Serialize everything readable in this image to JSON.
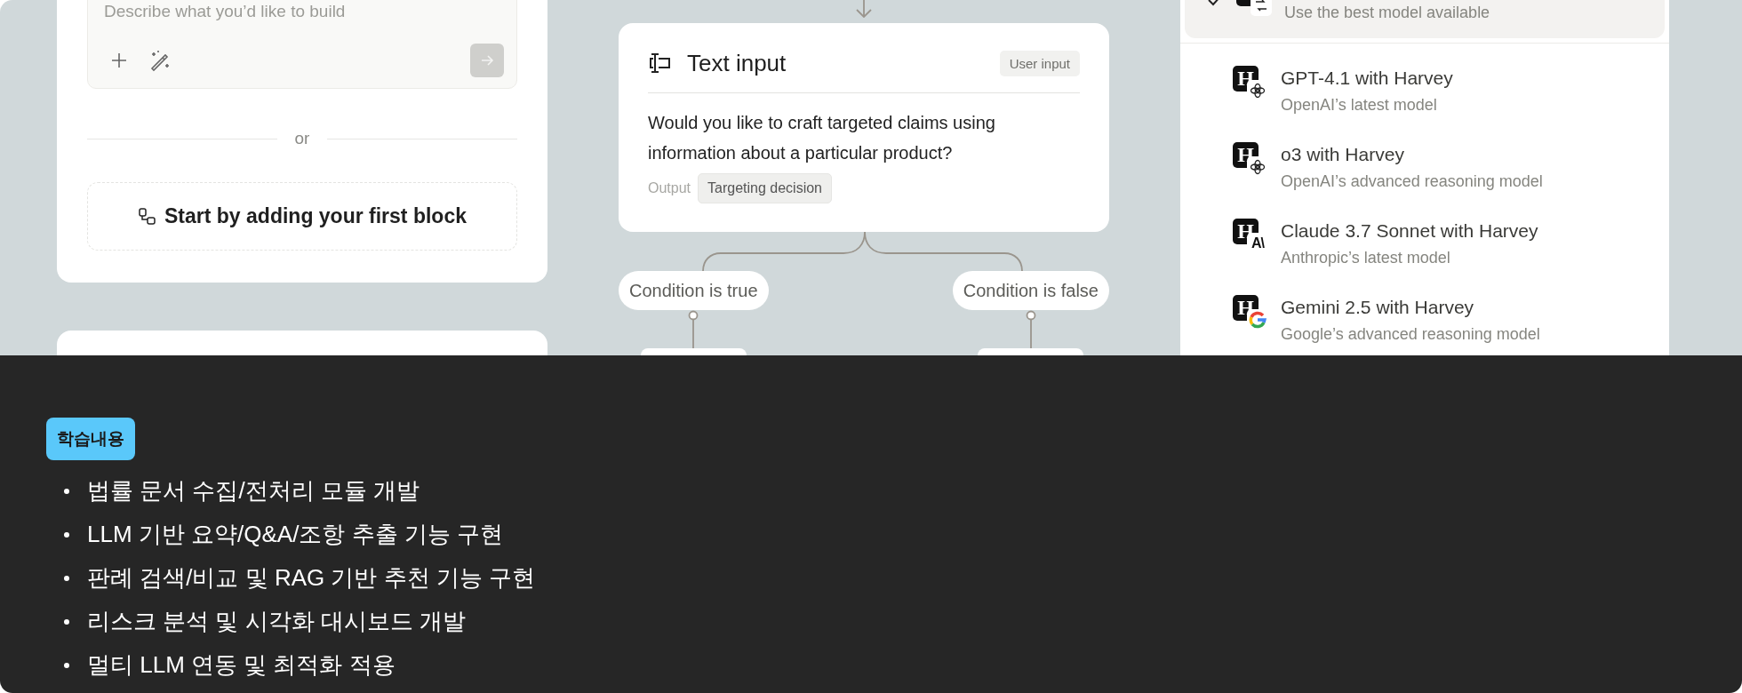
{
  "builder_card": {
    "prompt": {
      "placeholder": "Describe what you’d like to build"
    },
    "divider_label": "or",
    "start_button": "Start by adding your first block"
  },
  "flow": {
    "node": {
      "title": "Text input",
      "badge": "User input",
      "question": "Would you like to craft targeted claims using information about a particular product?",
      "output_label": "Output",
      "output_value": "Targeting decision"
    },
    "branches": [
      {
        "label": "Condition is true"
      },
      {
        "label": "Condition is false"
      }
    ]
  },
  "model_menu": {
    "items": [
      {
        "selected": true,
        "subtitle": "Use the best model available",
        "kind": "auto"
      },
      {
        "selected": false,
        "title": "GPT-4.1 with Harvey",
        "subtitle": "OpenAI’s latest model",
        "logo": "H",
        "kind": "knot"
      },
      {
        "selected": false,
        "title": "o3 with Harvey",
        "subtitle": "OpenAI’s advanced reasoning model",
        "logo": "H",
        "kind": "knot"
      },
      {
        "selected": false,
        "title": "Claude 3.7 Sonnet with Harvey",
        "subtitle": "Anthropic’s latest model",
        "logo": "H",
        "kind": "text",
        "badge_text": "A\\"
      },
      {
        "selected": false,
        "title": "Gemini 2.5 with Harvey",
        "subtitle": "Google’s advanced reasoning model",
        "logo": "H",
        "kind": "ring"
      }
    ]
  },
  "learning": {
    "badge": "학습내용",
    "items": [
      "법률 문서 수집/전처리 모듈 개발",
      "LLM 기반 요약/Q&A/조항 추출 기능 구현",
      "판례 검색/비교 및 RAG 기반 추천 기능 구현",
      "리스크 분석 및 시각화 대시보드 개발",
      "멀티 LLM 연동 및 최적화 적용"
    ]
  }
}
